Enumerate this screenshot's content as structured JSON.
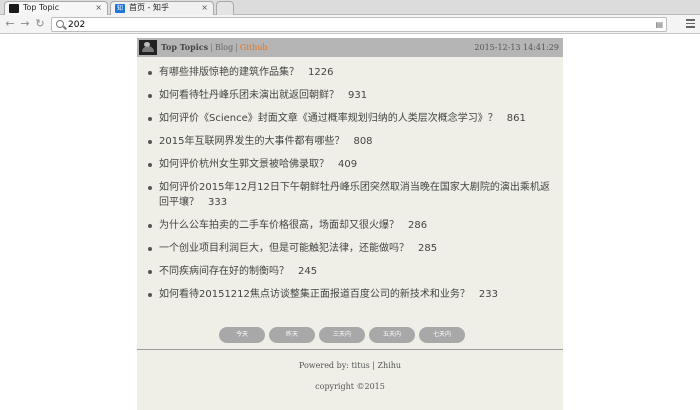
{
  "browser": {
    "tabs": [
      {
        "label": "Top Topic",
        "close": "×"
      },
      {
        "label": "首页 - 知乎",
        "favicon": "知",
        "close": "×"
      }
    ],
    "nav": {
      "back": "←",
      "forward": "→",
      "reload": "↻"
    },
    "url": "202",
    "page_action": "▤"
  },
  "header": {
    "site_title": "Top Topics",
    "sep1": "|",
    "blog": "Blog",
    "sep2": "|",
    "github": "Github",
    "datetime": "2015-12-13 14:41:29"
  },
  "topics": [
    {
      "title": "有哪些排版惊艳的建筑作品集？",
      "count": "1226"
    },
    {
      "title": "如何看待牡丹峰乐团未演出就返回朝鲜？",
      "count": "931"
    },
    {
      "title": "如何评价《Science》封面文章《通过概率规划归纳的人类层次概念学习》？",
      "count": "861"
    },
    {
      "title": "2015年互联网界发生的大事件都有哪些？",
      "count": "808"
    },
    {
      "title": "如何评价杭州女生郭文景被哈佛录取？",
      "count": "409"
    },
    {
      "title": "如何评价2015年12月12日下午朝鲜牡丹峰乐团突然取消当晚在国家大剧院的演出乘机返回平壤？",
      "count": "333"
    },
    {
      "title": "为什么公车拍卖的二手车价格很高，场面却又很火爆？",
      "count": "286"
    },
    {
      "title": "一个创业项目利润巨大，但是可能触犯法律，还能做吗？",
      "count": "285"
    },
    {
      "title": "不同疾病间存在好的制衡吗？",
      "count": "245"
    },
    {
      "title": "如何看待20151212焦点访谈整集正面报道百度公司的新技术和业务？",
      "count": "233"
    }
  ],
  "day_buttons": [
    "今天",
    "昨天",
    "三天内",
    "五天内",
    "七天内"
  ],
  "footer": {
    "powered": "Powered by: titus | Zhihu",
    "copyright": "copyright ©2015"
  }
}
